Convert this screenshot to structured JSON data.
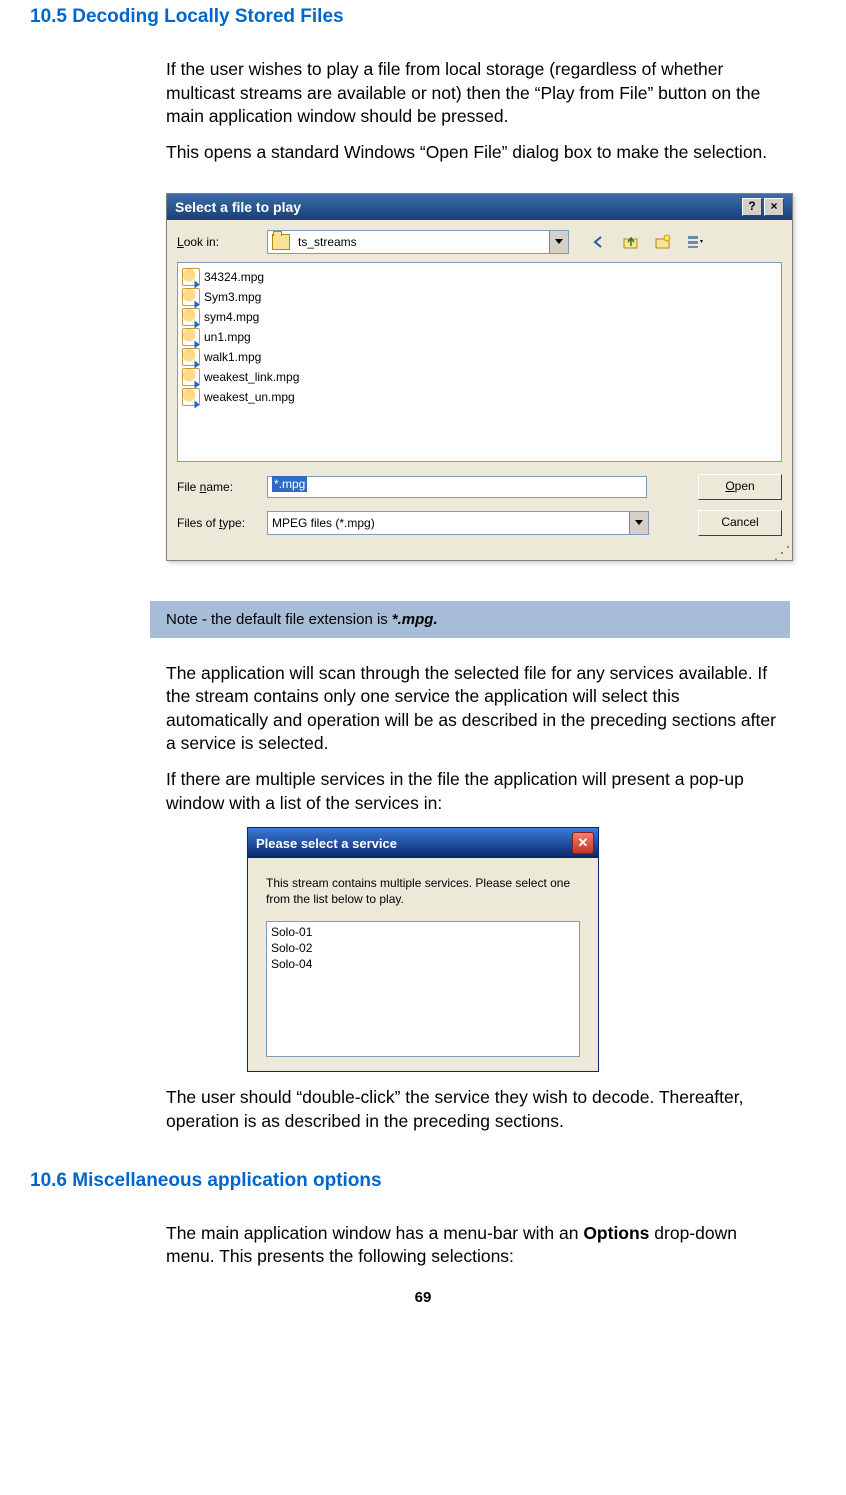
{
  "headings": {
    "sec_10_5": "10.5  Decoding Locally Stored Files",
    "sec_10_6": "10.6  Miscellaneous application options"
  },
  "paras": {
    "p1": "If the user wishes to play a file from local storage (regardless of whether multicast streams are available or not) then the “Play from File” button on the main application window should be pressed.",
    "p2": "This opens a standard Windows “Open File” dialog box to make the selection.",
    "p3": "The application will scan through the selected file for any services available. If the stream contains only one service the application will select this automatically and operation will be as described in the preceding sections after a service is selected.",
    "p4": "If there are multiple services in the file the application will present a pop-up window with a list of the services in:",
    "p5": "The user should “double-click” the service they wish to decode. Thereafter, operation is as described in the preceding sections.",
    "p6a": "The main application window has a menu-bar with an ",
    "p6b": "Options",
    "p6c": " drop-down menu. This presents the following selections:"
  },
  "note": {
    "prefix": "Note - the default file extension is ",
    "ext": "*.mpg."
  },
  "dlg1": {
    "title": "Select a file to play",
    "help": "?",
    "close": "×",
    "look_in_label": "Look in:",
    "folder": "ts_streams",
    "files": [
      "34324.mpg",
      "Sym3.mpg",
      "sym4.mpg",
      "un1.mpg",
      "walk1.mpg",
      "weakest_link.mpg",
      "weakest_un.mpg"
    ],
    "file_name_label": "File name:",
    "file_name_value": "*.mpg",
    "file_type_label": "Files of type:",
    "file_type_value": "MPEG files (*.mpg)",
    "open_btn": "Open",
    "cancel_btn": "Cancel"
  },
  "dlg2": {
    "title": "Please select a service",
    "text": "This stream contains multiple services. Please select one from the list below to play.",
    "items": [
      "Solo-01",
      "Solo-02",
      "Solo-04"
    ]
  },
  "page_number": "69"
}
